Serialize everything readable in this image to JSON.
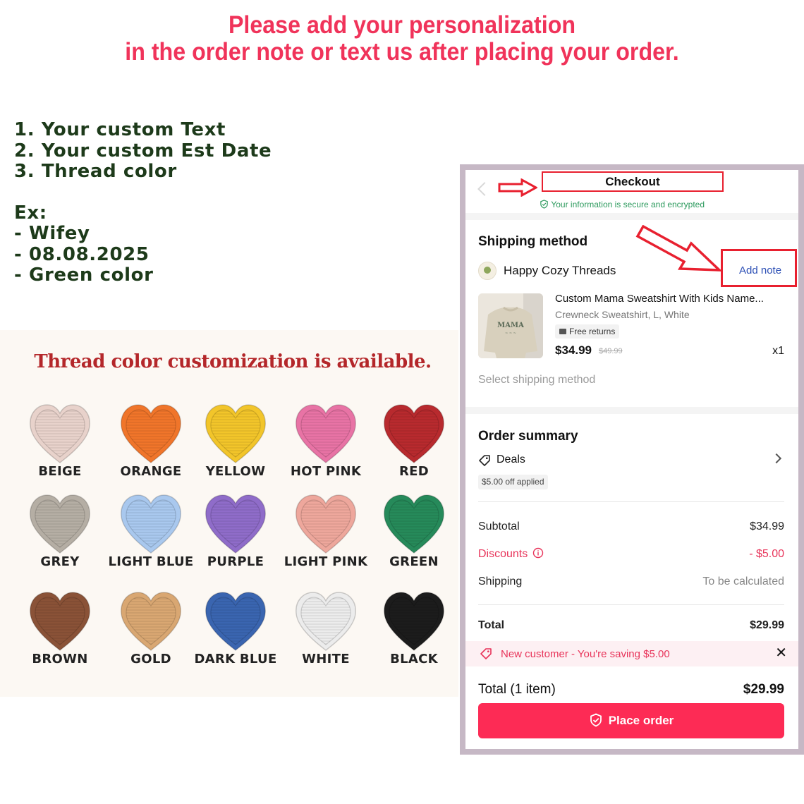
{
  "headline": {
    "line1": "Please add your personalization",
    "line2": "in the order note or text us after placing your order."
  },
  "instructions": {
    "lines": [
      "1. Your custom Text",
      "2. Your custom Est Date",
      "3. Thread color"
    ],
    "example_label": "Ex:",
    "examples": [
      "- Wifey",
      "- 08.08.2025",
      "- Green color"
    ]
  },
  "thread_colors": {
    "title": "Thread color customization is available.",
    "colors": [
      {
        "name": "BEIGE",
        "hex": "#e8d2cb"
      },
      {
        "name": "ORANGE",
        "hex": "#f0752a"
      },
      {
        "name": "YELLOW",
        "hex": "#f2c52a"
      },
      {
        "name": "HOT PINK",
        "hex": "#e873a5"
      },
      {
        "name": "RED",
        "hex": "#b82a2e"
      },
      {
        "name": "GREY",
        "hex": "#b5aea4"
      },
      {
        "name": "LIGHT BLUE",
        "hex": "#a9c8ee"
      },
      {
        "name": "PURPLE",
        "hex": "#8f6cc9"
      },
      {
        "name": "LIGHT PINK",
        "hex": "#eea79c"
      },
      {
        "name": "GREEN",
        "hex": "#268a5a"
      },
      {
        "name": "BROWN",
        "hex": "#8a5237"
      },
      {
        "name": "GOLD",
        "hex": "#d9a772"
      },
      {
        "name": "DARK BLUE",
        "hex": "#3a65b0"
      },
      {
        "name": "WHITE",
        "hex": "#ececec"
      },
      {
        "name": "BLACK",
        "hex": "#1c1c1c"
      }
    ]
  },
  "checkout": {
    "title": "Checkout",
    "secure_text": "Your information is secure and encrypted",
    "shipping_method_title": "Shipping method",
    "add_note": "Add note",
    "store_name": "Happy Cozy Threads",
    "product": {
      "name": "Custom Mama Sweatshirt With Kids Name...",
      "variant": "Crewneck Sweatshirt, L, White",
      "returns_badge": "Free returns",
      "price": "$34.99",
      "original_price": "$49.99",
      "quantity": "x1",
      "thumb_text": "MAMA"
    },
    "select_shipping": "Select shipping method",
    "order_summary_title": "Order summary",
    "deals_label": "Deals",
    "deals_badge": "$5.00 off applied",
    "subtotal_label": "Subtotal",
    "subtotal_value": "$34.99",
    "discounts_label": "Discounts",
    "discounts_value": "- $5.00",
    "shipping_label": "Shipping",
    "shipping_value": "To be calculated",
    "total_label": "Total",
    "total_value": "$29.99",
    "promo_text": "New customer - You're saving $5.00",
    "total_items_label": "Total",
    "total_items_count": "(1 item)",
    "total_items_value": "$29.99",
    "place_order": "Place order",
    "colors": {
      "accent": "#fd2b55",
      "link": "#2c4fb5",
      "secure": "#2c9a5d"
    }
  }
}
